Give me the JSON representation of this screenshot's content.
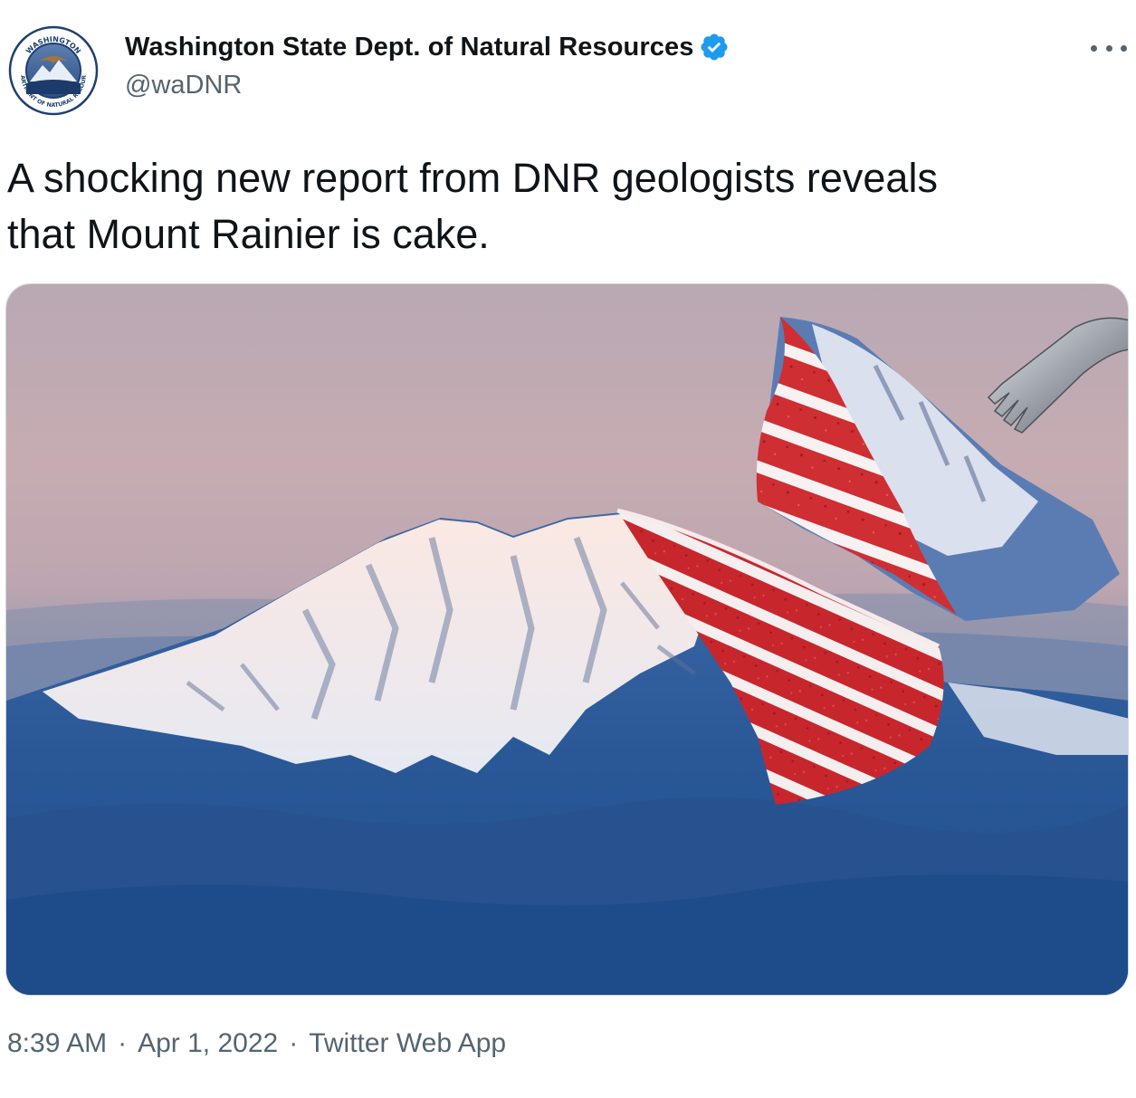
{
  "tweet": {
    "author": {
      "display_name": "Washington State Dept. of Natural Resources",
      "handle": "@waDNR",
      "verified": true,
      "avatar_seal_top": "WASHINGTON",
      "avatar_seal_bottom": "DEPARTMENT OF NATURAL RESOURCES"
    },
    "more_icon": "more-horizontal-icon",
    "text_line_1": "A shocking new report from DNR geologists reveals",
    "text_line_2": "that Mount Rainier is cake.",
    "media_alt": "Photo of Mount Rainier with a slice cut out revealing red velvet cake layers, and the slice lifted on a fork",
    "meta": {
      "time": "8:39 AM",
      "date": "Apr 1, 2022",
      "source": "Twitter Web App",
      "separator": "·"
    }
  },
  "colors": {
    "text_primary": "#0f1419",
    "text_secondary": "#536471",
    "verified_blue": "#1d9bf0",
    "media_border": "#cfd9de"
  }
}
